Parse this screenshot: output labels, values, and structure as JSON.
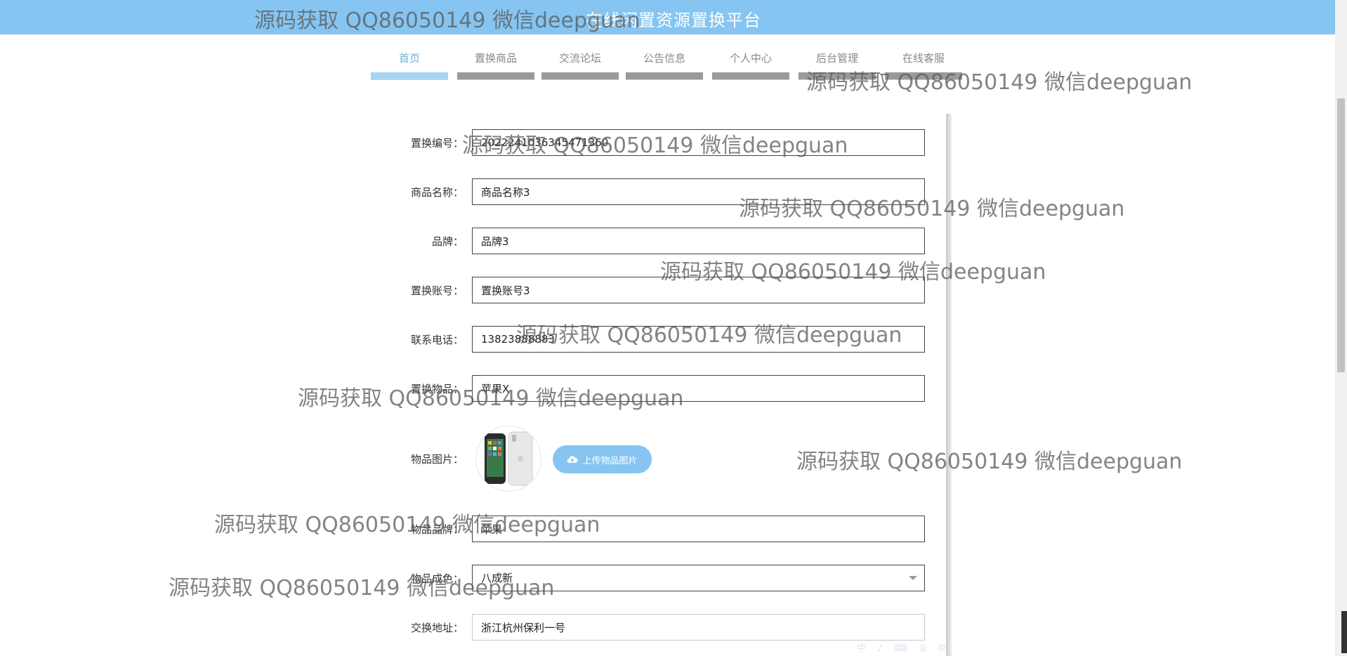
{
  "header": {
    "title": "在线闲置资源置换平台"
  },
  "nav": {
    "items": [
      {
        "label": "首页",
        "active": true
      },
      {
        "label": "置换商品",
        "active": false
      },
      {
        "label": "交流论坛",
        "active": false
      },
      {
        "label": "公告信息",
        "active": false
      },
      {
        "label": "个人中心",
        "active": false
      },
      {
        "label": "后台管理",
        "active": false
      },
      {
        "label": "在线客服",
        "active": false
      }
    ]
  },
  "form": {
    "exchange_no": {
      "label": "置换编号：",
      "value": "2022241036345471360"
    },
    "product_name": {
      "label": "商品名称：",
      "value": "商品名称3"
    },
    "brand": {
      "label": "品牌：",
      "value": "品牌3"
    },
    "exchange_account": {
      "label": "置换账号：",
      "value": "置换账号3"
    },
    "phone": {
      "label": "联系电话：",
      "value": "13823888883"
    },
    "exchange_item": {
      "label": "置换物品：",
      "value": "苹果X"
    },
    "item_image": {
      "label": "物品图片：",
      "upload_label": "上传物品图片",
      "icon": "cloud-upload-icon"
    },
    "item_brand": {
      "label": "物品品牌：",
      "value": "苹果"
    },
    "item_condition": {
      "label": "物品成色：",
      "value": "八成新"
    },
    "exchange_address": {
      "label": "交换地址：",
      "value": "浙江杭州保利一号"
    }
  },
  "watermark": {
    "text": "源码获取 QQ86050149 微信deepguan"
  },
  "ime_toolbar": {
    "text": "中 ♪ ⌨ ⊞ ⚙"
  },
  "colors": {
    "header_bg": "#86c5f1",
    "nav_active": "#6fb0de",
    "nav_bar": "#9a9a9a",
    "button_bg": "#86c5f1"
  }
}
